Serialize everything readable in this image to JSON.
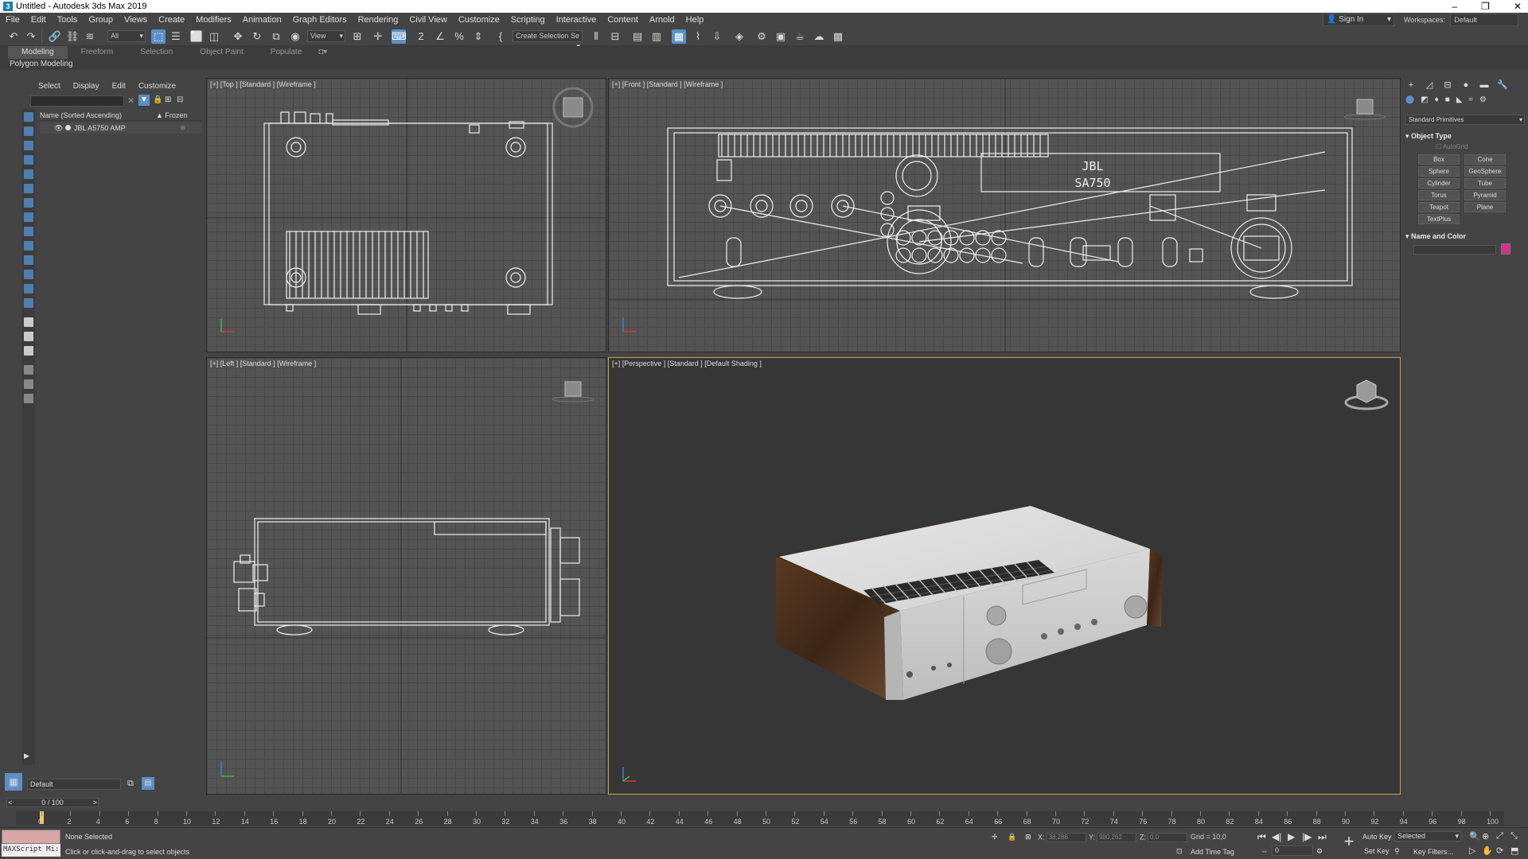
{
  "window": {
    "title": "Untitled - Autodesk 3ds Max 2019",
    "min": "‒",
    "restore": "❐",
    "close": "✕"
  },
  "menu": {
    "items": [
      "File",
      "Edit",
      "Tools",
      "Group",
      "Views",
      "Create",
      "Modifiers",
      "Animation",
      "Graph Editors",
      "Rendering",
      "Civil View",
      "Customize",
      "Scripting",
      "Interactive",
      "Content",
      "Arnold",
      "Help"
    ],
    "sign_in": "Sign In",
    "workspaces_label": "Workspaces:",
    "workspaces_value": "Default"
  },
  "toolbar": {
    "selection_filter": "All",
    "reference_coord": "View",
    "named_selection": "Create Selection Se"
  },
  "ribbon": {
    "tabs": [
      "Modeling",
      "Freeform",
      "Selection",
      "Object Paint",
      "Populate"
    ],
    "subtitle": "Polygon Modeling"
  },
  "explorer": {
    "tabs": [
      "Select",
      "Display",
      "Edit",
      "Customize"
    ],
    "col_name": "Name (Sorted Ascending)",
    "col_frozen": "▲ Frozen",
    "rows": [
      "JBL A5750 AMP"
    ]
  },
  "viewports": {
    "top": "[+] [Top ] [Standard ] [Wireframe ]",
    "front": "[+] [Front ] [Standard ] [Wireframe ]",
    "left": "[+] [Left ] [Standard ] [Wireframe ]",
    "persp": "[+] [Perspective ] [Standard ] [Default Shading ]",
    "front_display_line1": "JBL",
    "front_display_line2": "SA750"
  },
  "command_panel": {
    "category": "Standard Primitives",
    "object_type_title": "Object Type",
    "autogrid": "AutoGrid",
    "buttons": [
      "Box",
      "Cone",
      "Sphere",
      "GeoSphere",
      "Cylinder",
      "Tube",
      "Torus",
      "Pyramid",
      "Teapot",
      "Plane",
      "TextPlus"
    ],
    "name_color_title": "Name and Color",
    "object_color": "#d6308f"
  },
  "layer": {
    "name": "Default"
  },
  "timeline": {
    "frame_display": "0 / 100",
    "ticks": [
      0,
      2,
      4,
      6,
      8,
      10,
      12,
      14,
      16,
      18,
      20,
      22,
      24,
      26,
      28,
      30,
      32,
      34,
      36,
      38,
      40,
      42,
      44,
      46,
      48,
      50,
      52,
      54,
      56,
      58,
      60,
      62,
      64,
      66,
      68,
      70,
      72,
      74,
      76,
      78,
      80,
      82,
      84,
      86,
      88,
      90,
      92,
      94,
      96,
      98,
      100
    ]
  },
  "status": {
    "maxscript": "MAXScript Mi:",
    "selection": "None Selected",
    "prompt": "Click or click-and-drag to select objects",
    "x_label": "X:",
    "x_val": "38,286",
    "y_label": "Y:",
    "y_val": "980,262",
    "z_label": "Z:",
    "z_val": "0,0",
    "grid": "Grid = 10,0",
    "add_time_tag": "Add Time Tag",
    "auto_key": "Auto Key",
    "set_key": "Set Key",
    "selected": "Selected",
    "key_filters": "Key Filters...",
    "frame_field": "0"
  }
}
